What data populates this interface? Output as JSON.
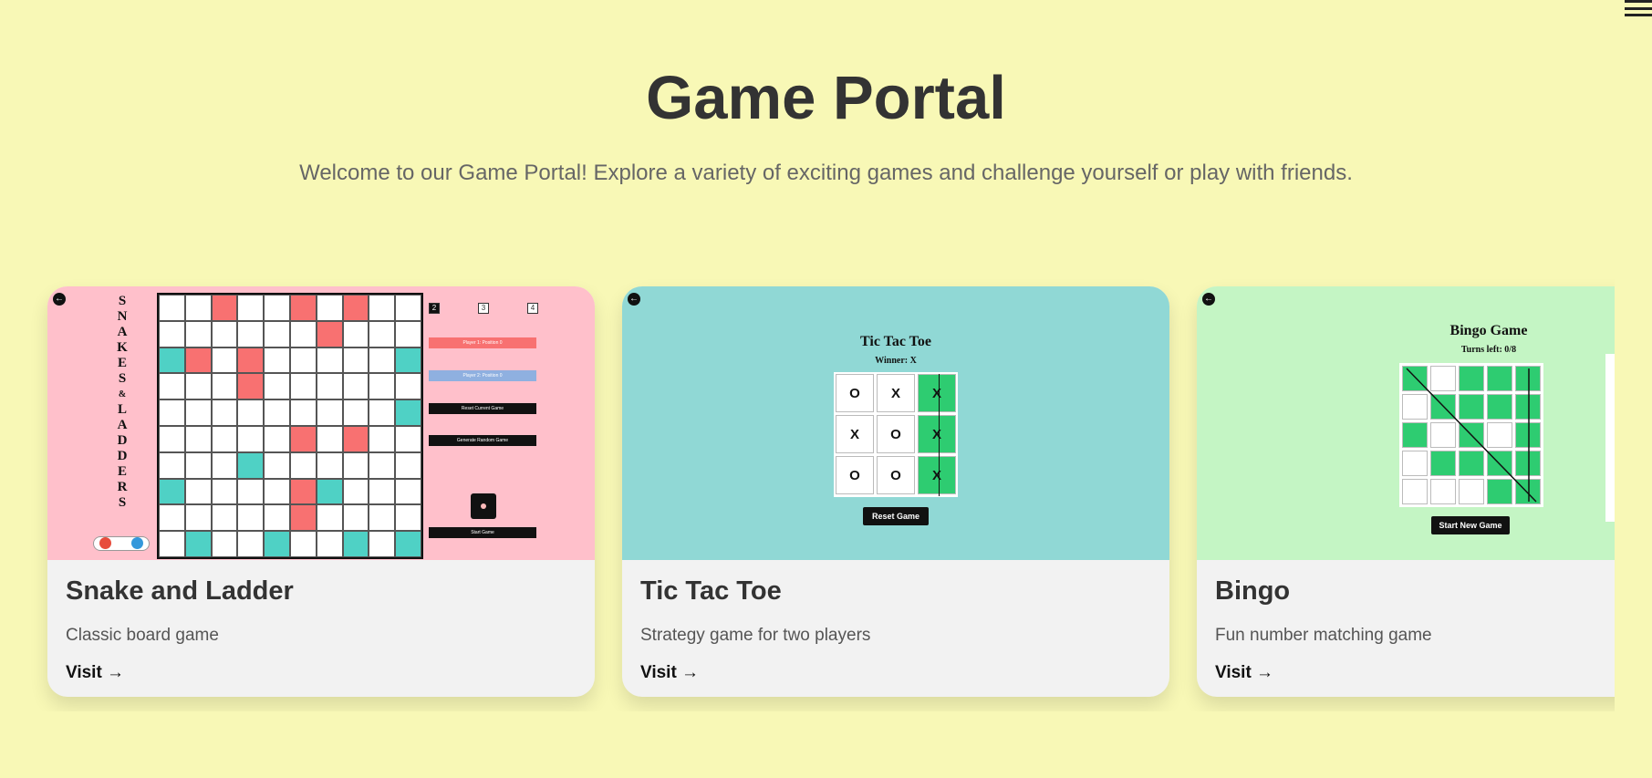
{
  "page": {
    "title": "Game Portal",
    "subtitle": "Welcome to our Game Portal! Explore a variety of exciting games and challenge yourself or play with friends."
  },
  "header": {
    "menu_icon": "hamburger-menu-icon"
  },
  "games": [
    {
      "name": "Snake and Ladder",
      "description": "Classic board game",
      "visit_label": "Visit →",
      "thumbnail_bg": "#ffc0cb",
      "thumbnail": {
        "vertical_title": [
          "S",
          "N",
          "A",
          "K",
          "E",
          "S",
          "&",
          "L",
          "A",
          "D",
          "D",
          "E",
          "R",
          "S"
        ],
        "player_numbers": [
          "2",
          "3",
          "4"
        ],
        "player1_label": "Player 1: Position 0",
        "player2_label": "Player 2: Position 0",
        "reset_label": "Reset Current Game",
        "generate_label": "Generate Random Game",
        "start_label": "Start Game"
      }
    },
    {
      "name": "Tic Tac Toe",
      "description": "Strategy game for two players",
      "visit_label": "Visit →",
      "thumbnail_bg": "#90d8d5",
      "thumbnail": {
        "title": "Tic Tac Toe",
        "winner": "Winner: X",
        "cells": [
          "O",
          "X",
          "X",
          "X",
          "O",
          "X",
          "O",
          "O",
          "X"
        ],
        "reset_label": "Reset Game"
      }
    },
    {
      "name": "Bingo",
      "description": "Fun number matching game",
      "visit_label": "Visit →",
      "thumbnail_bg": "#c4f5c4",
      "thumbnail": {
        "title": "Bingo Game",
        "turns": "Turns left: 0/8",
        "start_label": "Start New Game"
      }
    }
  ],
  "colors": {
    "background": "#f8f8b6",
    "card_footer": "#f2f2f2",
    "win_green": "#2ecc71",
    "snake_red": "#f87171",
    "ladder_teal": "#4fd1c5"
  }
}
